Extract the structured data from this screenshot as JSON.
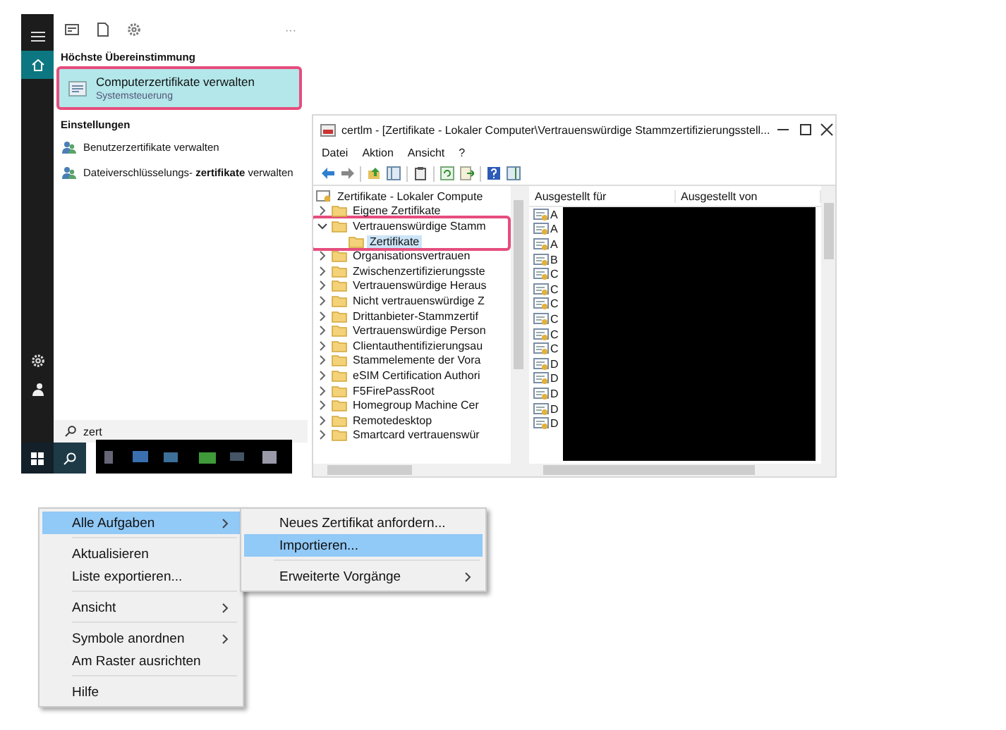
{
  "start_menu": {
    "rail": [
      {
        "kind": "menu",
        "selected": false
      },
      {
        "kind": "home",
        "selected": true
      },
      {
        "kind": "settings",
        "selected": false
      },
      {
        "kind": "user",
        "selected": false
      }
    ],
    "toolbar_more": "···",
    "best_match": {
      "heading": "Höchste Übereinstimmung",
      "title": "Computerzertifikate verwalten",
      "subtitle": "Systemsteuerung",
      "selected": true,
      "highlighted": true
    },
    "settings": {
      "heading": "Einstellungen",
      "items": [
        "Benutzerzertifikate verwalten",
        "Dateiverschlüsselungs- **zertifikate** verwalten"
      ]
    },
    "search": {
      "value": "zert"
    },
    "taskbar": {
      "search_active": true
    }
  },
  "certlm": {
    "title": "certlm - [Zertifikate - Lokaler Computer\\Vertrauenswürdige Stammzertifizierungsstell...",
    "menu": [
      "Datei",
      "Aktion",
      "Ansicht",
      "?"
    ],
    "tree": {
      "label": "Zertifikate - Lokaler Compute",
      "children": [
        {
          "label": "Eigene Zertifikate",
          "expanded": false,
          "selected": false,
          "highlighted": false
        },
        {
          "label": "Vertrauenswürdige Stamm",
          "expanded": true,
          "selected": false,
          "highlighted": true,
          "children": [
            {
              "label": "Zertifikate",
              "selected": true
            }
          ]
        },
        {
          "label": "Organisationsvertrauen",
          "expanded": false,
          "selected": false,
          "highlighted": false
        },
        {
          "label": "Zwischenzertifizierungsste",
          "expanded": false,
          "selected": false,
          "highlighted": false
        },
        {
          "label": "Vertrauenswürdige Heraus",
          "expanded": false,
          "selected": false,
          "highlighted": false
        },
        {
          "label": "Nicht vertrauenswürdige Z",
          "expanded": false,
          "selected": false,
          "highlighted": false
        },
        {
          "label": "Drittanbieter-Stammzertif",
          "expanded": false,
          "selected": false,
          "highlighted": false
        },
        {
          "label": "Vertrauenswürdige Person",
          "expanded": false,
          "selected": false,
          "highlighted": false
        },
        {
          "label": "Clientauthentifizierungsau",
          "expanded": false,
          "selected": false,
          "highlighted": false
        },
        {
          "label": "Stammelemente der Vora",
          "expanded": false,
          "selected": false,
          "highlighted": false
        },
        {
          "label": "eSIM Certification Authori",
          "expanded": false,
          "selected": false,
          "highlighted": false
        },
        {
          "label": "F5FirePassRoot",
          "expanded": false,
          "selected": false,
          "highlighted": false
        },
        {
          "label": "Homegroup Machine Cer",
          "expanded": false,
          "selected": false,
          "highlighted": false
        },
        {
          "label": "Remotedesktop",
          "expanded": false,
          "selected": false,
          "highlighted": false
        },
        {
          "label": "Smartcard vertrauenswür",
          "expanded": false,
          "selected": false,
          "highlighted": false
        }
      ]
    },
    "columns": [
      "Ausgestellt für",
      "Ausgestellt von"
    ],
    "rows": [
      "A",
      "A",
      "A",
      "B",
      "C",
      "C",
      "C",
      "C",
      "C",
      "C",
      "D",
      "D",
      "D",
      "D",
      "D"
    ]
  },
  "context_menu": {
    "items": [
      {
        "kind": "item",
        "label": "Alle Aufgaben",
        "submenu": true,
        "selected": true
      },
      {
        "kind": "separator"
      },
      {
        "kind": "item",
        "label": "Aktualisieren",
        "submenu": false,
        "selected": false
      },
      {
        "kind": "item",
        "label": "Liste exportieren...",
        "submenu": false,
        "selected": false
      },
      {
        "kind": "separator"
      },
      {
        "kind": "item",
        "label": "Ansicht",
        "submenu": true,
        "selected": false
      },
      {
        "kind": "separator"
      },
      {
        "kind": "item",
        "label": "Symbole anordnen",
        "submenu": true,
        "selected": false
      },
      {
        "kind": "item",
        "label": "Am Raster ausrichten",
        "submenu": false,
        "selected": false
      },
      {
        "kind": "separator"
      },
      {
        "kind": "item",
        "label": "Hilfe",
        "submenu": false,
        "selected": false
      }
    ],
    "submenu": [
      {
        "kind": "item",
        "label": "Neues Zertifikat anfordern...",
        "submenu": false,
        "selected": false
      },
      {
        "kind": "item",
        "label": "Importieren...",
        "submenu": false,
        "selected": true
      },
      {
        "kind": "separator"
      },
      {
        "kind": "item",
        "label": "Erweiterte Vorgänge",
        "submenu": true,
        "selected": false
      }
    ]
  }
}
